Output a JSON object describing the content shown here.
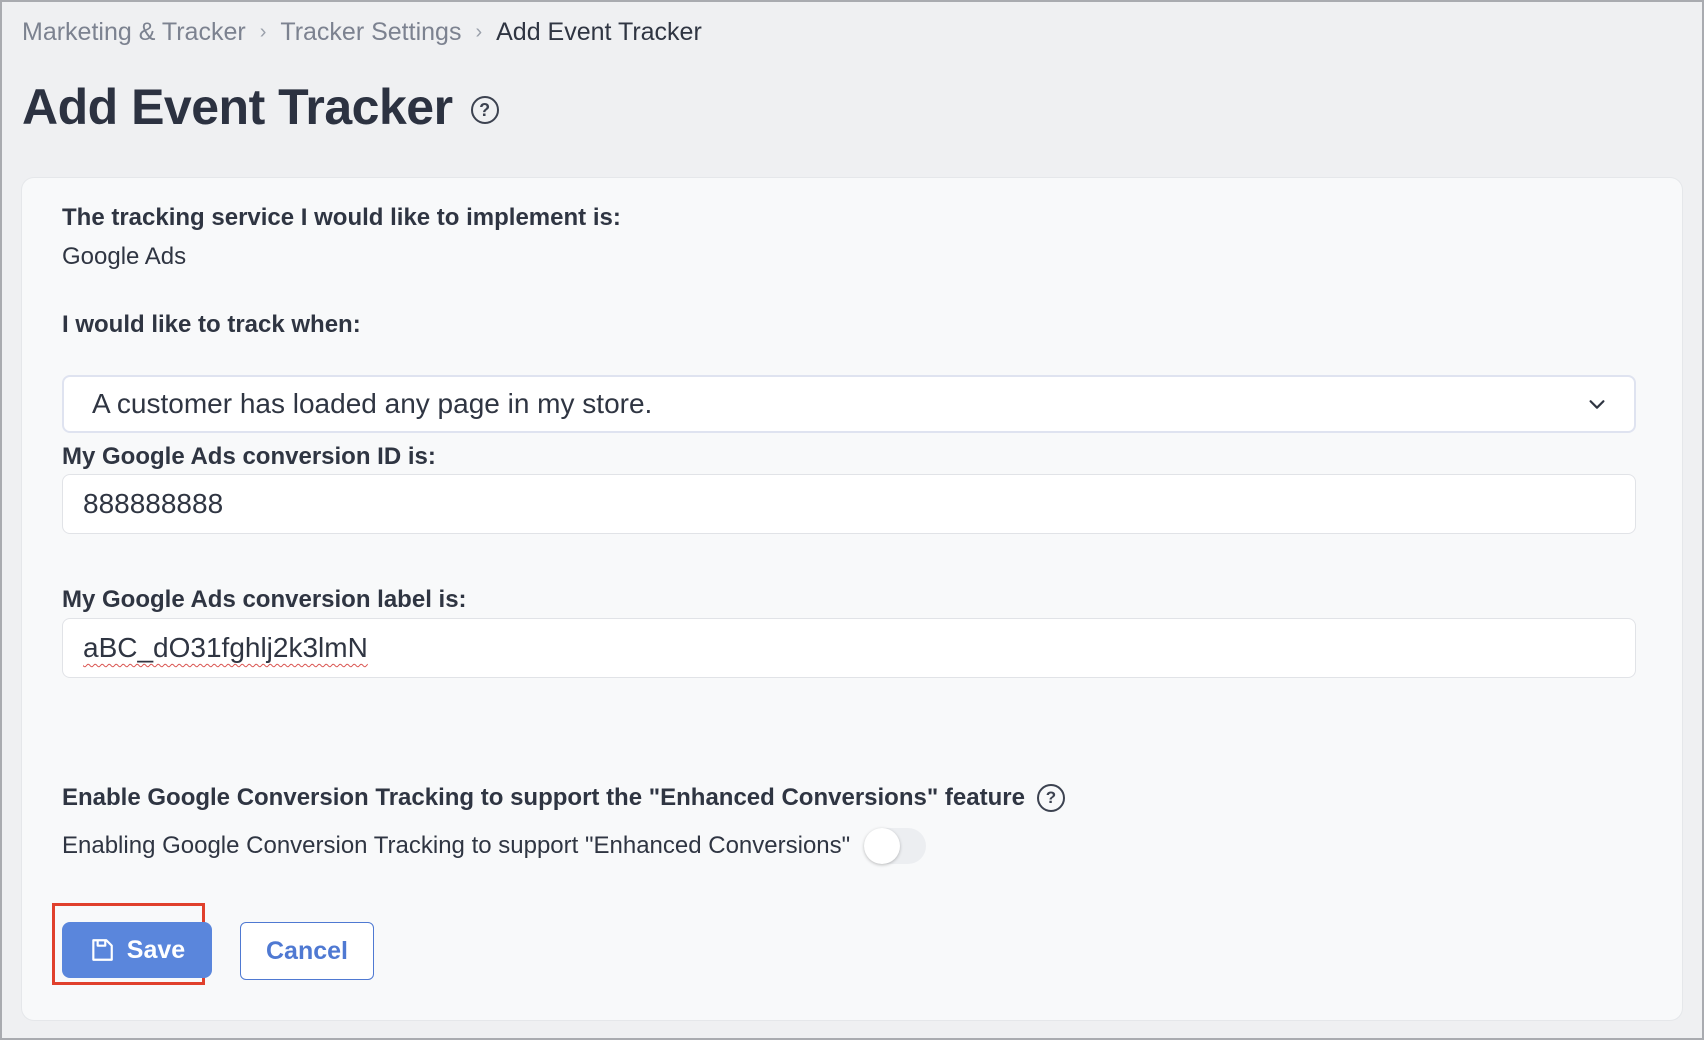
{
  "breadcrumb": {
    "items": [
      "Marketing & Tracker",
      "Tracker Settings"
    ],
    "current": "Add Event Tracker",
    "separator": "›"
  },
  "page": {
    "title": "Add Event Tracker",
    "help_icon": "question-circle-icon"
  },
  "form": {
    "service_label": "The tracking service I would like to implement is:",
    "service_value": "Google Ads",
    "track_when_label": "I would like to track when:",
    "track_when_selected": "A customer has loaded any page in my store.",
    "conversion_id_label": "My Google Ads conversion ID is:",
    "conversion_id_value": "888888888",
    "conversion_label_label": "My Google Ads conversion label is:",
    "conversion_label_value": "aBC_dO31fghlj2k3lmN",
    "enhanced_label": "Enable Google Conversion Tracking to support the \"Enhanced Conversions\" feature",
    "enhanced_toggle_text": "Enabling Google Conversion Tracking to support \"Enhanced Conversions\"",
    "enhanced_toggle_on": false
  },
  "actions": {
    "save_label": "Save",
    "cancel_label": "Cancel",
    "save_icon": "floppy-disk-icon"
  },
  "colors": {
    "primary": "#5a86dc",
    "highlight": "#e0402c"
  }
}
